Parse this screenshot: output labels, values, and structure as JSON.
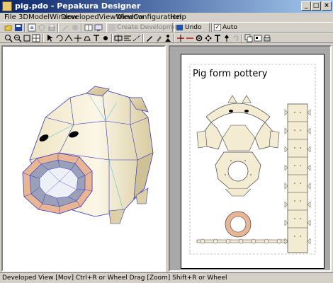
{
  "window": {
    "title": "pig.pdo - Pepakura Designer",
    "controls": {
      "minimize": "_",
      "maximize": "□",
      "close": "×"
    }
  },
  "menu": [
    {
      "label": "File"
    },
    {
      "label": "3DModelWindow"
    },
    {
      "label": "DevelopedViewWindow"
    },
    {
      "label": "View"
    },
    {
      "label": "Configuration"
    },
    {
      "label": "Help"
    }
  ],
  "toolbar": {
    "create_development_label": "Create Development",
    "undo_label": "Undo",
    "auto_label": "Auto",
    "auto_checked": "✓"
  },
  "developed_view": {
    "paper_title": "Pig form pottery"
  },
  "status": {
    "text": "Developed View [Mov] Ctrl+R or Wheel Drag [Zoom] Shift+R or Wheel"
  },
  "colors": {
    "paper_part_fill": "#f3ecd2",
    "snout_fill": "#e8b694",
    "edge_blue": "#3030c0",
    "edge_cyan": "#30c0c0"
  }
}
